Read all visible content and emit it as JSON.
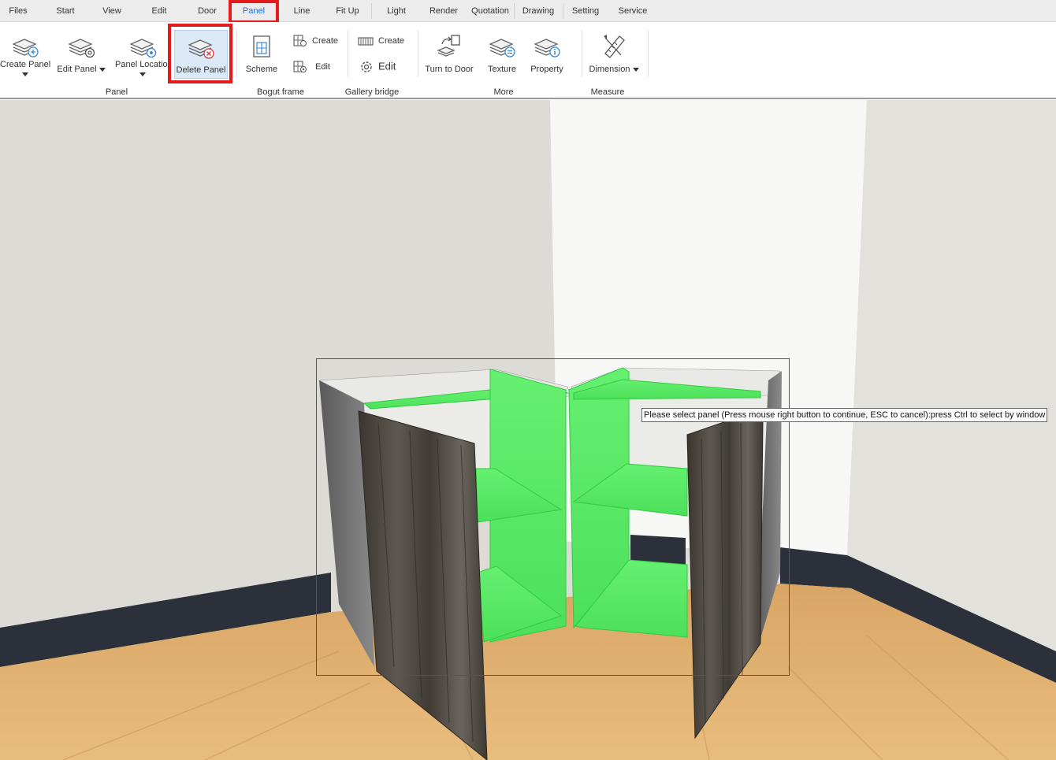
{
  "menu": {
    "items": [
      "Files",
      "Start",
      "View",
      "Edit",
      "Door",
      "Panel",
      "Line",
      "Fit Up",
      "Light",
      "Render",
      "Quotation",
      "Drawing",
      "Setting",
      "Service"
    ],
    "active": "Panel"
  },
  "ribbon": {
    "create_panel": "Create Panel",
    "edit_panel": "Edit Panel",
    "panel_location": "Panel Location",
    "delete_panel": "Delete Panel",
    "scheme": "Scheme",
    "bogut_create": "Create",
    "bogut_edit": "Edit",
    "gallery_create": "Create",
    "gallery_edit": "Edit",
    "turn_to_door": "Turn to Door",
    "texture": "Texture",
    "property": "Property",
    "dimension": "Dimension",
    "groups": {
      "panel": "Panel",
      "bogut_frame": "Bogut frame",
      "gallery_bridge": "Gallery bridge",
      "more": "More",
      "measure": "Measure"
    }
  },
  "viewport": {
    "tooltip": "Please select panel (Press mouse right button to continue, ESC to cancel):press Ctrl to select by window"
  },
  "colors": {
    "highlight": "#e41b1b",
    "active_tab": "#1e6fd6",
    "selected_panel": "#5ef06a",
    "wood": "#4a463f",
    "floor": "#d8a564"
  }
}
